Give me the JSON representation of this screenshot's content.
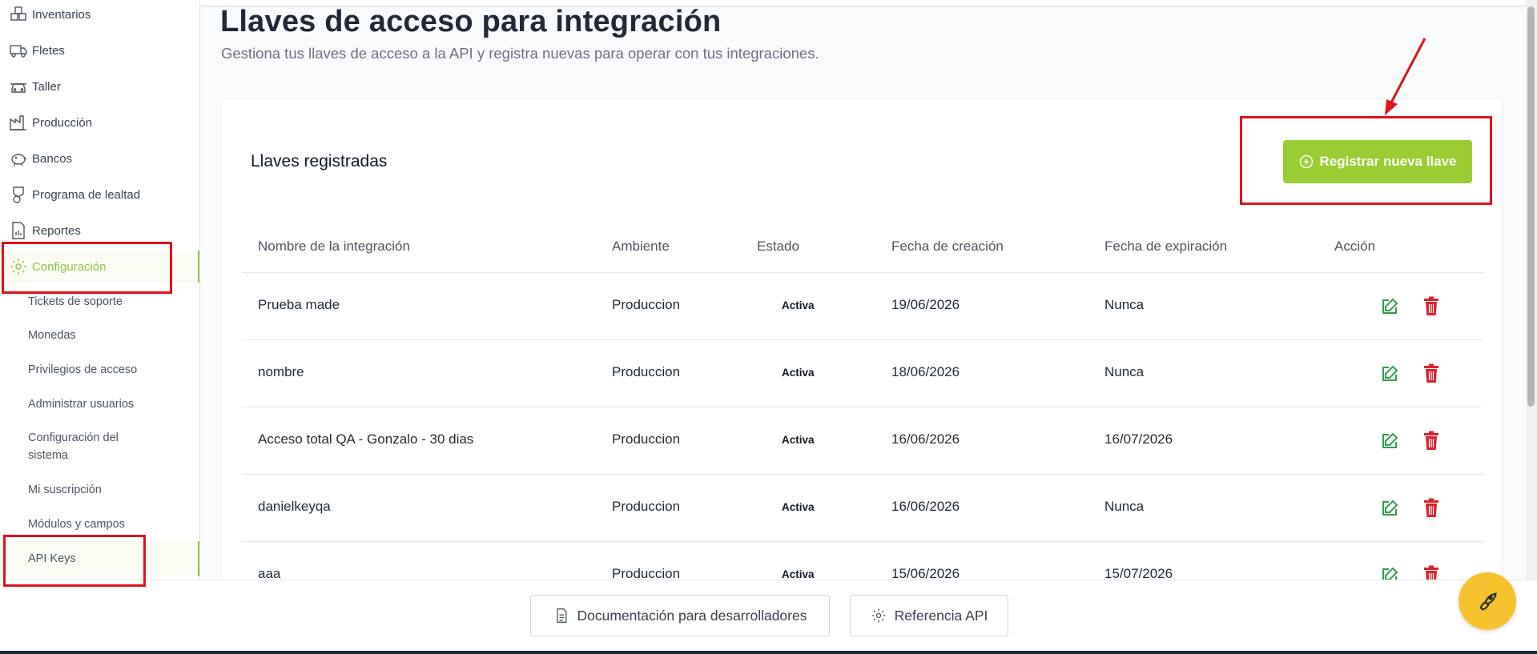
{
  "sidebar": {
    "items": [
      {
        "label": "Inventarios",
        "icon": "boxes-icon"
      },
      {
        "label": "Fletes",
        "icon": "truck-icon"
      },
      {
        "label": "Taller",
        "icon": "car-icon"
      },
      {
        "label": "Producción",
        "icon": "factory-icon"
      },
      {
        "label": "Bancos",
        "icon": "piggy-bank-icon"
      },
      {
        "label": "Programa de lealtad",
        "icon": "loyalty-icon"
      },
      {
        "label": "Reportes",
        "icon": "report-icon"
      },
      {
        "label": "Configuración",
        "icon": "gear-icon"
      }
    ],
    "subitems": [
      {
        "label": "Tickets de soporte"
      },
      {
        "label": "Monedas"
      },
      {
        "label": "Privilegios de acceso"
      },
      {
        "label": "Administrar usuarios"
      },
      {
        "label": "Configuración del sistema"
      },
      {
        "label": "Mi suscripción"
      },
      {
        "label": "Módulos y campos"
      },
      {
        "label": "API Keys"
      }
    ]
  },
  "header": {
    "title": "Llaves de acceso para integración",
    "subtitle": "Gestiona tus llaves de acceso a la API y registra nuevas para operar con tus integraciones."
  },
  "card": {
    "title": "Llaves registradas",
    "register_label": "Registrar nueva llave"
  },
  "table": {
    "columns": [
      "Nombre de la integración",
      "Ambiente",
      "Estado",
      "Fecha de creación",
      "Fecha de expiración",
      "Acción"
    ],
    "rows": [
      {
        "name": "Prueba made",
        "env": "Produccion",
        "status": "Activa",
        "created": "19/06/2026",
        "expires": "Nunca"
      },
      {
        "name": "nombre",
        "env": "Produccion",
        "status": "Activa",
        "created": "18/06/2026",
        "expires": "Nunca"
      },
      {
        "name": "Acceso total QA - Gonzalo - 30 dias",
        "env": "Produccion",
        "status": "Activa",
        "created": "16/06/2026",
        "expires": "16/07/2026"
      },
      {
        "name": "danielkeyqa",
        "env": "Produccion",
        "status": "Activa",
        "created": "16/06/2026",
        "expires": "Nunca"
      },
      {
        "name": "aaa",
        "env": "Produccion",
        "status": "Activa",
        "created": "15/06/2026",
        "expires": "15/07/2026"
      }
    ]
  },
  "footer": {
    "docs_label": "Documentación para desarrolladores",
    "api_ref_label": "Referencia API"
  },
  "colors": {
    "accent": "#9acd32",
    "annotation": "#e0121b",
    "edit": "#2e9e4d",
    "delete": "#d9232d",
    "fab": "#f6c22d"
  }
}
